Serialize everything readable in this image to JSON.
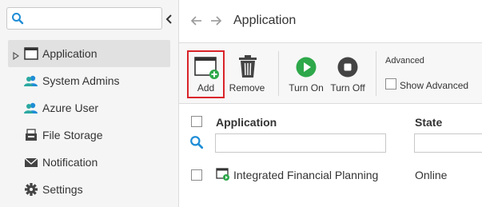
{
  "sidebar": {
    "search": {
      "value": "",
      "placeholder": ""
    },
    "items": [
      {
        "label": "Application",
        "icon": "window-icon",
        "active": true
      },
      {
        "label": "System Admins",
        "icon": "users-icon"
      },
      {
        "label": "Azure User",
        "icon": "users-icon"
      },
      {
        "label": "File Storage",
        "icon": "file-storage-icon"
      },
      {
        "label": "Notification",
        "icon": "envelope-icon"
      },
      {
        "label": "Settings",
        "icon": "gear-icon"
      }
    ]
  },
  "header": {
    "title": "Application"
  },
  "toolbar": {
    "add_label": "Add",
    "remove_label": "Remove",
    "turn_on_label": "Turn On",
    "turn_off_label": "Turn Off",
    "advanced_title": "Advanced",
    "show_advanced_label": "Show Advanced"
  },
  "grid": {
    "columns": [
      "Application",
      "State"
    ],
    "filters": {
      "application": "",
      "state": ""
    },
    "rows": [
      {
        "application": "Integrated Financial Planning",
        "state": "Online"
      }
    ]
  },
  "colors": {
    "accent_blue": "#1f8dd6",
    "teal_user": "#2aa8a0",
    "green_on": "#2ea84a",
    "dark_icon": "#444444",
    "highlight_red": "#d9232a"
  }
}
